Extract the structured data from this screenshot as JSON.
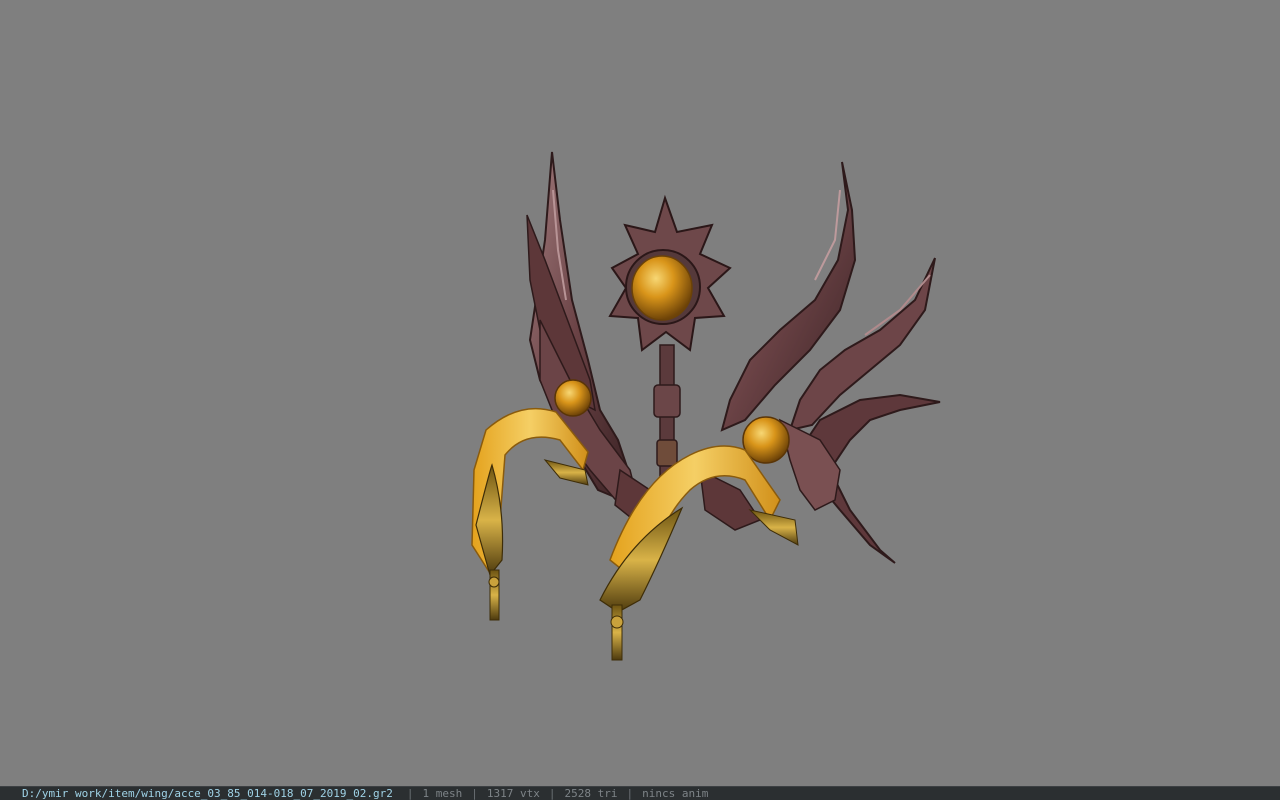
{
  "viewport": {
    "background_color": "#7f7f7f",
    "model_description_icon": "wing-accessory-model"
  },
  "statusbar": {
    "file_path": "D:/ymir work/item/wing/acce_03_85_014-018_07_2019_02.gr2",
    "separator": "|",
    "mesh_count": "1 mesh",
    "vertex_count": "1317 vtx",
    "triangle_count": "2528 tri",
    "animation": "nincs anim"
  },
  "colors": {
    "metal_dark": "#4a2b2b",
    "metal_mid": "#7a4d4f",
    "metal_light": "#a27c7e",
    "gold": "#e0a21a",
    "gold_light": "#f3c84a",
    "ribbon": "#f1b63b",
    "path_text": "#9fd2e6"
  }
}
